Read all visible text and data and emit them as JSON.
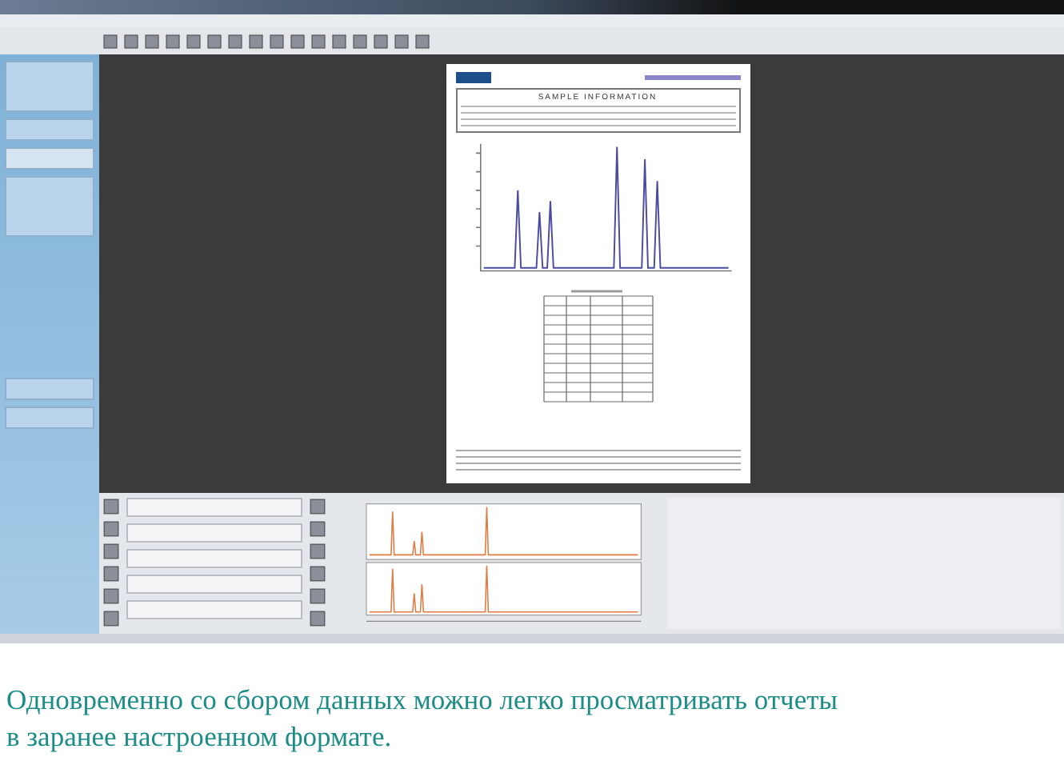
{
  "report": {
    "section_title": "SAMPLE INFORMATION"
  },
  "caption": {
    "text": "Одновременно со сбором данных можно легко просматривать отчеты\nв заранее настроенном формате."
  }
}
